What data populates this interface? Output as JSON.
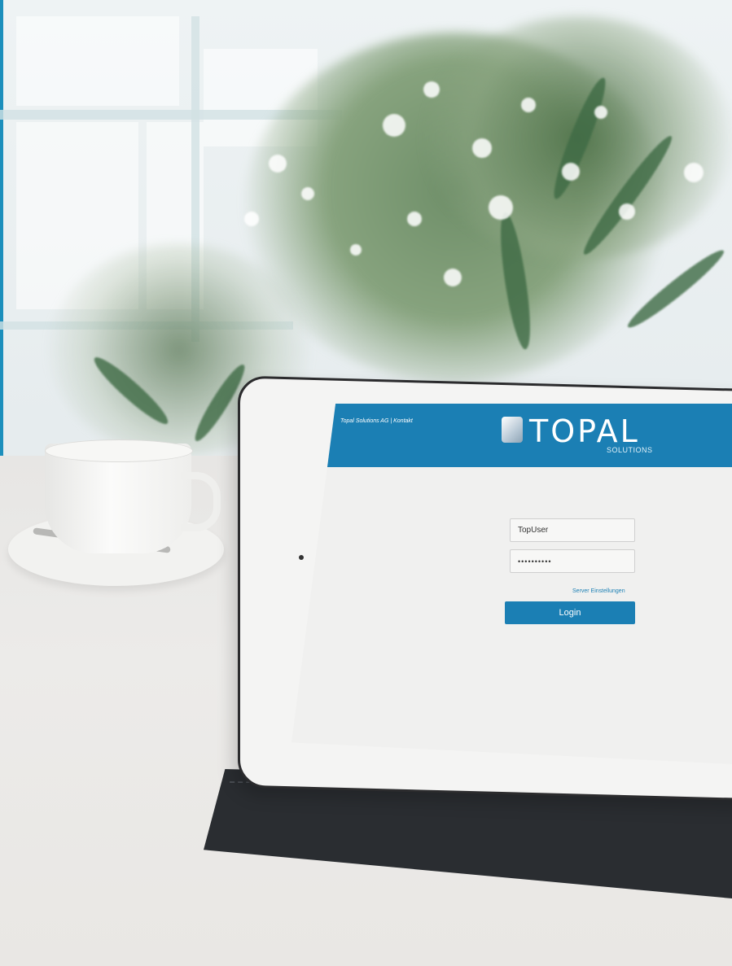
{
  "app": {
    "header": {
      "company_link": "Topal Solutions AG | Kontakt",
      "logo_text": "TOPAL",
      "logo_subtext": "SOLUTIONS"
    },
    "login_form": {
      "username_value": "TopUser",
      "password_value": "••••••••••",
      "server_settings_link": "Server Einstellungen",
      "login_button": "Login"
    },
    "colors": {
      "brand_blue": "#1b7fb4",
      "screen_background": "#f0f0ef"
    },
    "icons": [
      "topal-logo-cube-icon"
    ]
  }
}
